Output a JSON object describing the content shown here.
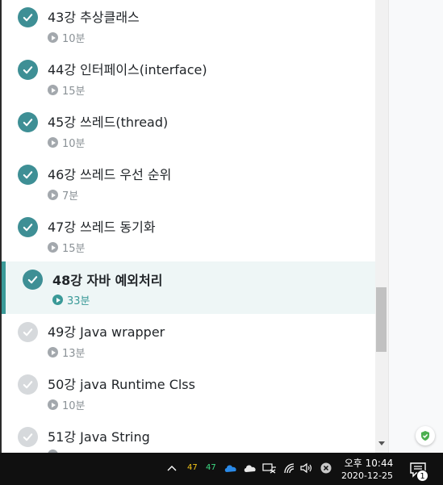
{
  "lessons": [
    {
      "title": "43강 추상클래스",
      "duration": "10분",
      "status": "completed"
    },
    {
      "title": "44강 인터페이스(interface)",
      "duration": "15분",
      "status": "completed"
    },
    {
      "title": "45강 쓰레드(thread)",
      "duration": "10분",
      "status": "completed"
    },
    {
      "title": "46강 쓰레드 우선 순위",
      "duration": "7분",
      "status": "completed"
    },
    {
      "title": "47강 쓰레드 동기화",
      "duration": "15분",
      "status": "completed"
    },
    {
      "title": "48강 자바 예외처리",
      "duration": "33분",
      "status": "current"
    },
    {
      "title": "49강 Java wrapper",
      "duration": "13분",
      "status": "pending"
    },
    {
      "title": "50강 java Runtime Clss",
      "duration": "10분",
      "status": "pending"
    },
    {
      "title": "51강 Java String",
      "duration": "",
      "status": "pending"
    }
  ],
  "colors": {
    "accent": "#3a9a98",
    "check_completed": "#3e8f95",
    "check_pending": "#d6d9dc",
    "active_bg": "#eef6f6"
  },
  "taskbar": {
    "tray_num_1": "47",
    "tray_num_2": "47",
    "time": "오후 10:44",
    "date": "2020-12-25",
    "notification_count": "1"
  }
}
